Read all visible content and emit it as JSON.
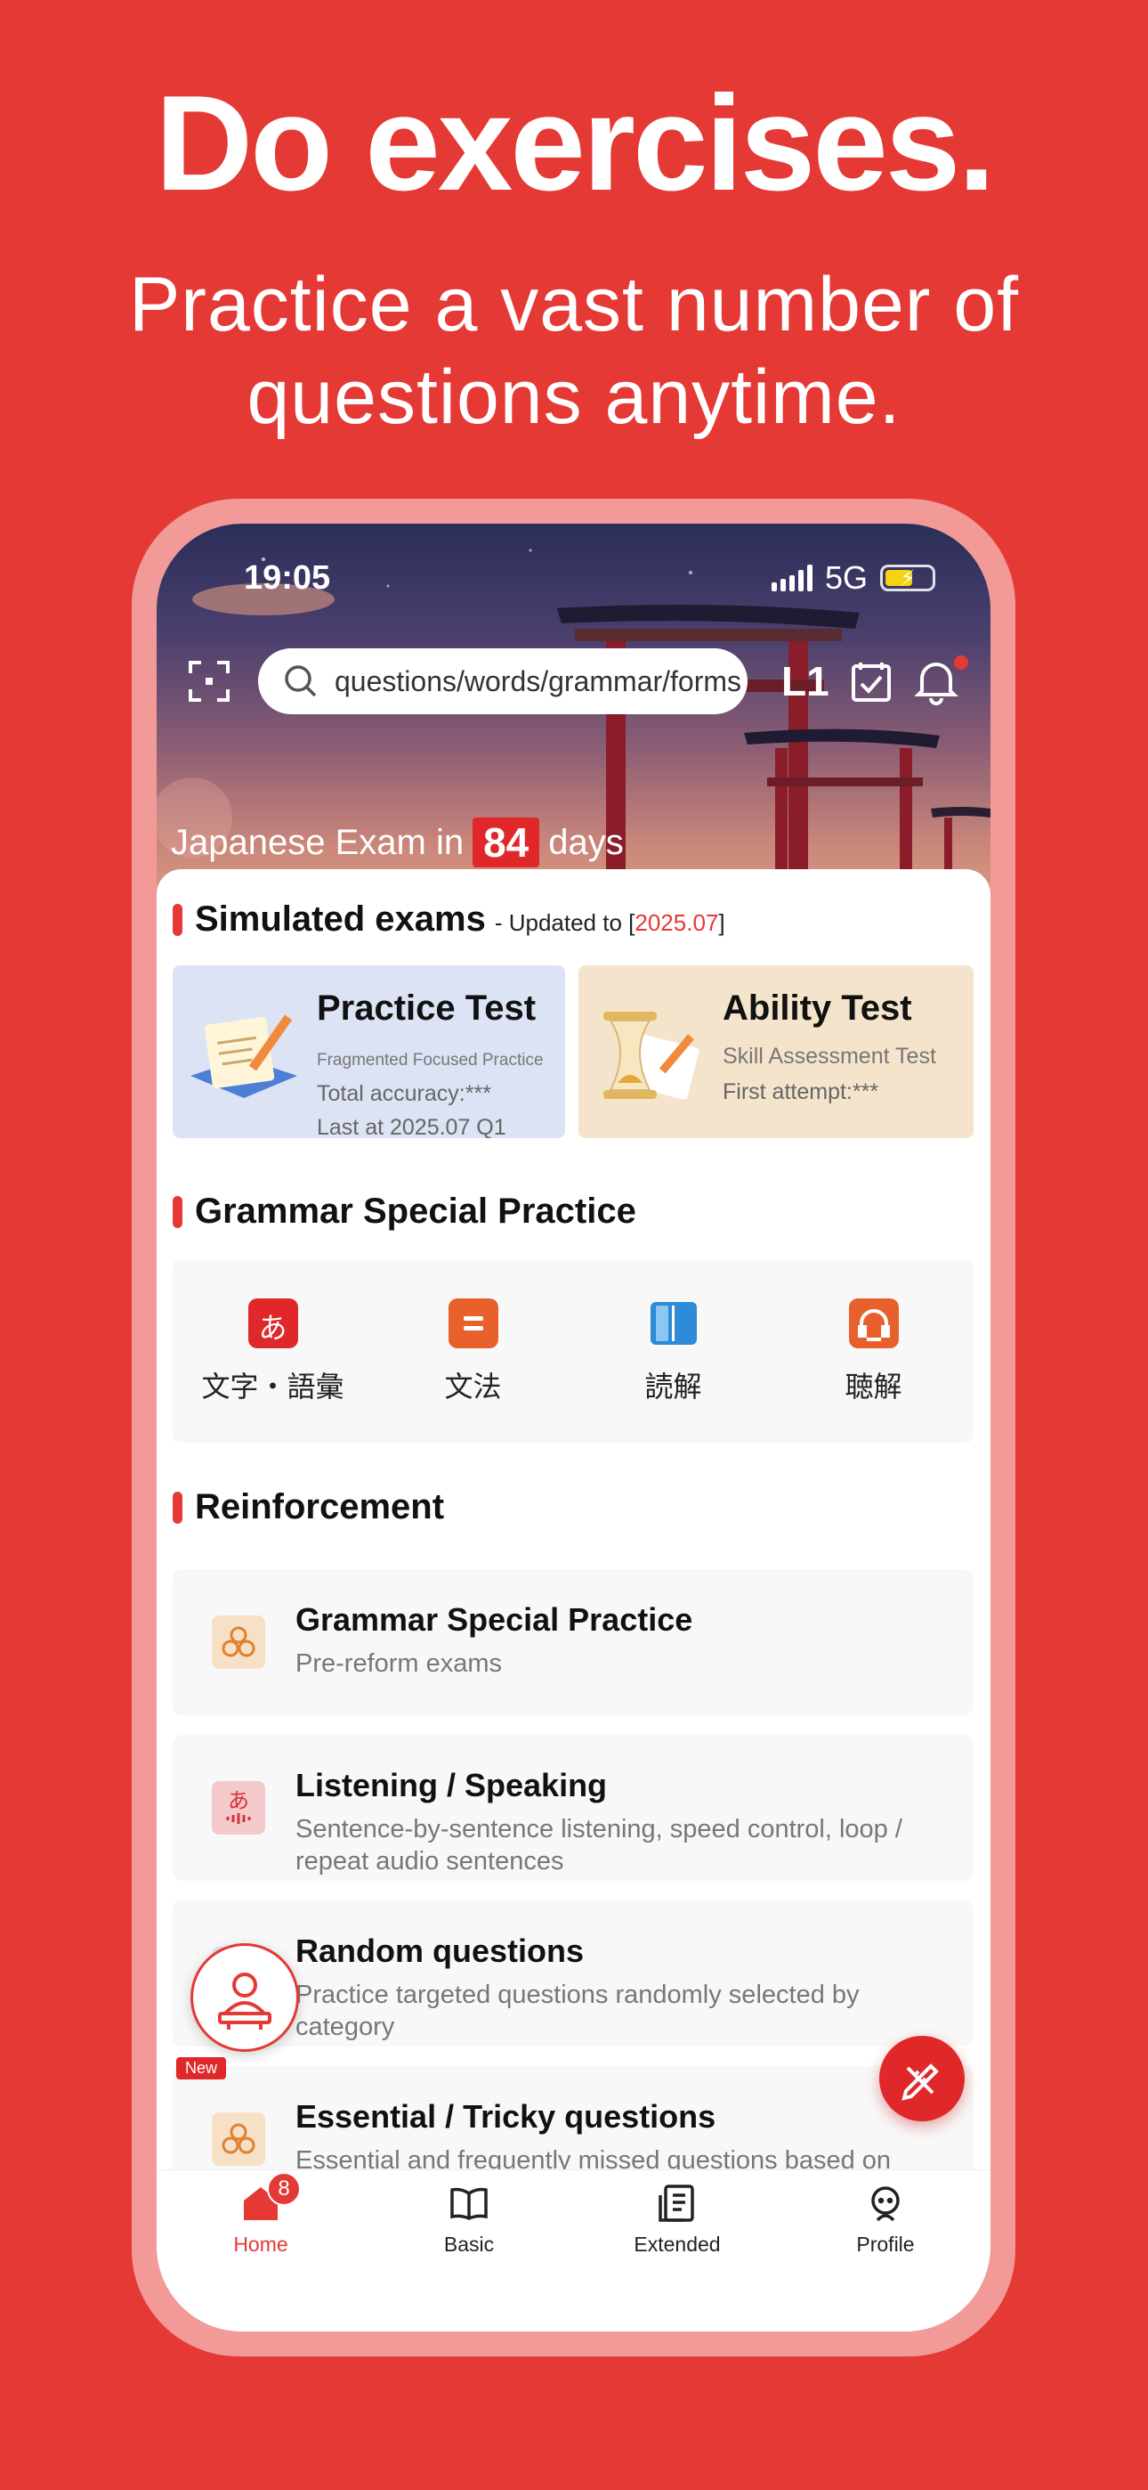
{
  "headline": "Do exercises.",
  "subline_1": "Practice a vast number of",
  "subline_2": "questions anytime.",
  "status": {
    "time": "19:05",
    "network": "5G"
  },
  "search": {
    "placeholder": "questions/words/grammar/forms"
  },
  "level": "L1",
  "countdown": {
    "prefix": "Japanese Exam in",
    "days": "84",
    "suffix": "days"
  },
  "simulated": {
    "title": "Simulated exams",
    "updated_prefix": "- Updated to [",
    "updated_value": "2025.07",
    "updated_suffix": "]",
    "practice": {
      "title": "Practice Test",
      "subtitle": "Fragmented Focused Practice",
      "accuracy": "Total accuracy:***",
      "last": "Last at 2025.07 Q1"
    },
    "ability": {
      "title": "Ability Test",
      "subtitle": "Skill Assessment Test",
      "attempt": "First attempt:***"
    }
  },
  "grammar": {
    "title": "Grammar Special Practice",
    "items": [
      {
        "label": "文字・語彙",
        "icon": "kana-icon",
        "color": "#E0282A"
      },
      {
        "label": "文法",
        "icon": "document-icon",
        "color": "#E8602C"
      },
      {
        "label": "読解",
        "icon": "book-icon",
        "color": "#2D8BD8"
      },
      {
        "label": "聴解",
        "icon": "headphones-icon",
        "color": "#E8602C"
      }
    ]
  },
  "reinforcement": {
    "title": "Reinforcement",
    "items": [
      {
        "title": "Grammar Special Practice",
        "desc": "Pre-reform exams"
      },
      {
        "title": "Listening / Speaking",
        "desc": "Sentence-by-sentence listening, speed control, loop / repeat audio sentences"
      },
      {
        "title": "Random questions",
        "desc": "Practice targeted questions randomly selected by category"
      },
      {
        "title": "Essential / Tricky questions",
        "desc": "Essential and frequently missed questions based on"
      }
    ]
  },
  "new_badge": "New",
  "tabs": [
    {
      "label": "Home",
      "badge": "8"
    },
    {
      "label": "Basic"
    },
    {
      "label": "Extended"
    },
    {
      "label": "Profile"
    }
  ],
  "colors": {
    "brand": "#E53935",
    "frame": "#F29A98"
  }
}
